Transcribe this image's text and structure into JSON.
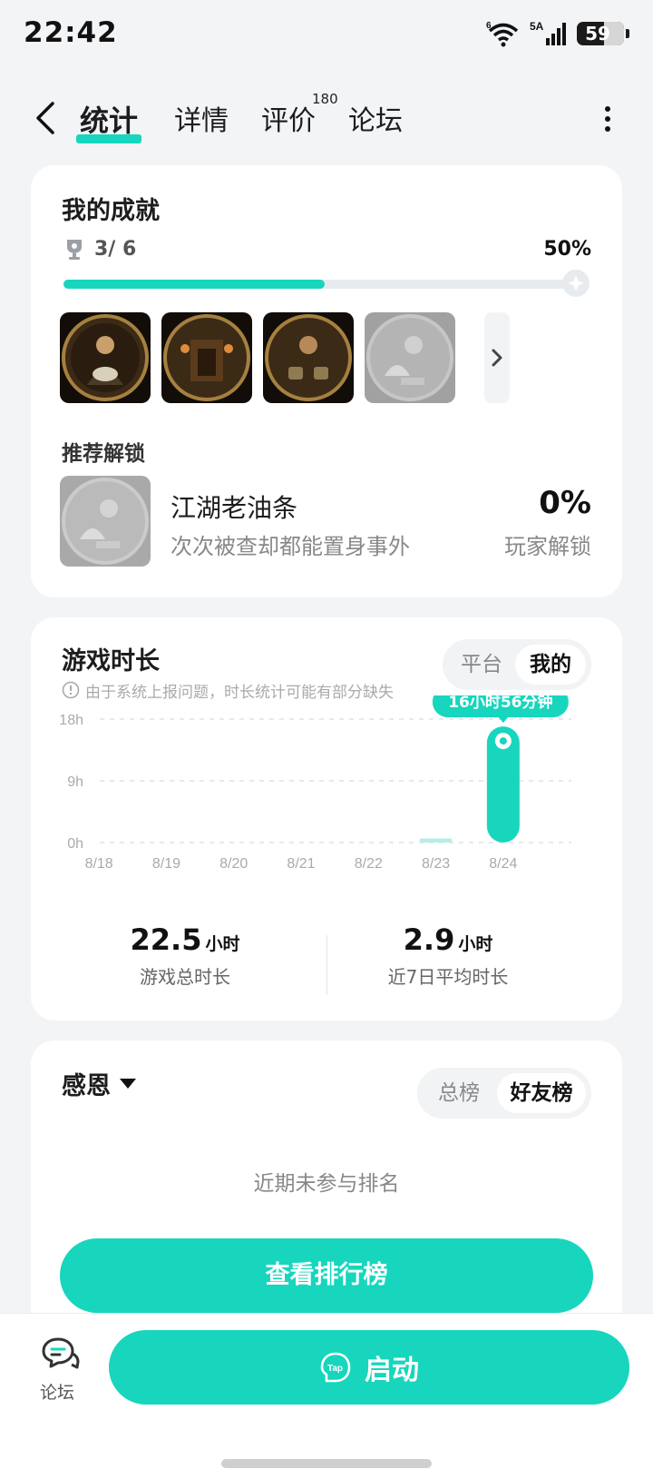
{
  "status_bar": {
    "time": "22:42",
    "wifi_badge": "6",
    "network": "5A",
    "battery": "59"
  },
  "nav": {
    "tabs": [
      {
        "label": "统计",
        "active": true
      },
      {
        "label": "详情"
      },
      {
        "label": "评价",
        "badge": "180"
      },
      {
        "label": "论坛"
      }
    ]
  },
  "achievements": {
    "title": "我的成就",
    "count": "3/ 6",
    "percent_text": "50%",
    "progress": 0.5,
    "unlocked_thumbs": 3,
    "locked_thumbs": 1
  },
  "recommend": {
    "title": "推荐解锁",
    "name": "江湖老油条",
    "desc": "次次被查却都能置身事外",
    "percent": "0%",
    "percent_label": "玩家解锁"
  },
  "playtime": {
    "title": "游戏时长",
    "warning": "由于系统上报问题，时长统计可能有部分缺失",
    "toggle": [
      {
        "label": "平台"
      },
      {
        "label": "我的",
        "active": true
      }
    ],
    "total_value": "22.5",
    "total_unit": "小时",
    "total_label": "游戏总时长",
    "avg_value": "2.9",
    "avg_unit": "小时",
    "avg_label": "近7日平均时长"
  },
  "chart_data": {
    "type": "bar",
    "categories": [
      "8/18",
      "8/19",
      "8/20",
      "8/21",
      "8/22",
      "8/23",
      "8/24"
    ],
    "values": [
      0,
      0,
      0,
      0,
      0,
      0.6,
      16.93
    ],
    "yticks": [
      "0h",
      "9h",
      "18h"
    ],
    "ylim": [
      0,
      18
    ],
    "highlight_label": "16小时56分钟",
    "bar_color": "#17d6bd",
    "faint_bar_color": "#b4eee6",
    "grid": true
  },
  "ranking": {
    "title": "感恩",
    "toggle": [
      {
        "label": "总榜"
      },
      {
        "label": "好友榜",
        "active": true
      }
    ],
    "empty_text": "近期未参与排名",
    "button_label": "查看排行榜"
  },
  "bottom_bar": {
    "forum_label": "论坛",
    "launch_label": "启动",
    "tap_logo_text": "Tap"
  },
  "colors": {
    "accent": "#17d6bd"
  }
}
